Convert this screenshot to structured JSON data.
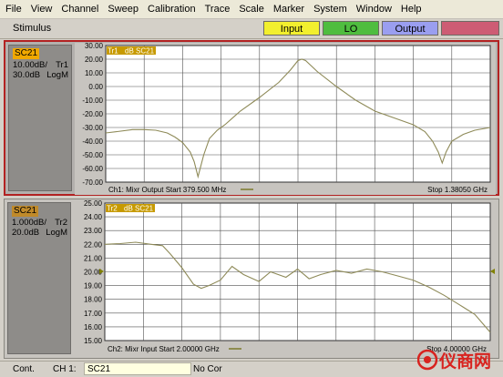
{
  "menu": [
    "File",
    "View",
    "Channel",
    "Sweep",
    "Calibration",
    "Trace",
    "Scale",
    "Marker",
    "System",
    "Window",
    "Help"
  ],
  "stimulus_bar": {
    "label": "Stimulus",
    "buttons": [
      {
        "label": "Input",
        "color": "#f2ef2e"
      },
      {
        "label": "LO",
        "color": "#4fbd3f"
      },
      {
        "label": "Output",
        "color": "#9a9ef0"
      },
      {
        "label": "",
        "color": "#cd5c74"
      }
    ]
  },
  "ch1": {
    "trace_name": "SC21",
    "scale": "10.00dB/",
    "trace_id": "Tr1",
    "ref": "30.0dB",
    "format": "LogM",
    "trace_label": "Tr1",
    "trace_param": "dB SC21",
    "y_ticks": [
      "30.00",
      "20.00",
      "10.00",
      "0.00",
      "-10.00",
      "-20.00",
      "-30.00",
      "-40.00",
      "-50.00",
      "-60.00",
      "-70.00"
    ],
    "start_text": "Ch1: Mixr Output Start  379.500 MHz",
    "stop_text": "Stop  1.38050 GHz"
  },
  "ch2": {
    "trace_name": "SC21",
    "scale": "1.000dB/",
    "trace_id": "Tr2",
    "ref": "20.0dB",
    "format": "LogM",
    "trace_label": "Tr2",
    "trace_param": "dB SC21",
    "y_ticks": [
      "25.00",
      "24.00",
      "23.00",
      "22.00",
      "21.00",
      "20.00",
      "19.00",
      "18.00",
      "17.00",
      "16.00",
      "15.00"
    ],
    "start_text": "Ch2: Mixr Input Start  2.00000 GHz",
    "stop_text": "Stop  4.00000 GHz"
  },
  "chart_data": [
    {
      "type": "line",
      "title": "Ch1: Mixr Output",
      "x_start": "379.500 MHz",
      "x_stop": "1.38050 GHz",
      "ylim": [
        -70,
        30
      ],
      "grid": true,
      "series": [
        {
          "name": "Tr1 dB SC21",
          "x": [
            0,
            0.03,
            0.07,
            0.1,
            0.13,
            0.16,
            0.18,
            0.2,
            0.22,
            0.23,
            0.24,
            0.255,
            0.27,
            0.29,
            0.31,
            0.35,
            0.4,
            0.45,
            0.48,
            0.5,
            0.51,
            0.52,
            0.55,
            0.6,
            0.65,
            0.7,
            0.75,
            0.8,
            0.83,
            0.85,
            0.865,
            0.875,
            0.885,
            0.9,
            0.93,
            0.96,
            1.0
          ],
          "values": [
            -34,
            -33,
            -31.5,
            -31.5,
            -32,
            -34,
            -37,
            -41,
            -48,
            -55,
            -66,
            -50,
            -38,
            -32,
            -28,
            -18,
            -8,
            3,
            12,
            19,
            20,
            19,
            11,
            0,
            -10,
            -18,
            -23,
            -28,
            -33,
            -40,
            -48,
            -56,
            -48,
            -40,
            -35,
            -32,
            -30
          ]
        }
      ]
    },
    {
      "type": "line",
      "title": "Ch2: Mixr Input",
      "x_start": "2.00000 GHz",
      "x_stop": "4.00000 GHz",
      "ylim": [
        15,
        25
      ],
      "grid": true,
      "series": [
        {
          "name": "Tr2 dB SC21",
          "x": [
            0,
            0.04,
            0.08,
            0.12,
            0.15,
            0.17,
            0.2,
            0.23,
            0.25,
            0.27,
            0.3,
            0.33,
            0.36,
            0.4,
            0.43,
            0.47,
            0.5,
            0.53,
            0.56,
            0.6,
            0.64,
            0.68,
            0.72,
            0.76,
            0.8,
            0.84,
            0.88,
            0.92,
            0.96,
            1.0
          ],
          "values": [
            22.0,
            22.05,
            22.15,
            22.0,
            21.9,
            21.3,
            20.3,
            19.1,
            18.8,
            19.0,
            19.4,
            20.4,
            19.8,
            19.3,
            20.0,
            19.6,
            20.2,
            19.5,
            19.8,
            20.1,
            19.9,
            20.2,
            20.0,
            19.7,
            19.4,
            18.9,
            18.3,
            17.6,
            16.9,
            15.6
          ]
        }
      ]
    }
  ],
  "status": {
    "mode": "Cont.",
    "channel": "CH 1:",
    "measurement": "SC21",
    "correction": "No Cor"
  },
  "logo": {
    "text": "仪商网",
    "color": "#d8231f"
  }
}
